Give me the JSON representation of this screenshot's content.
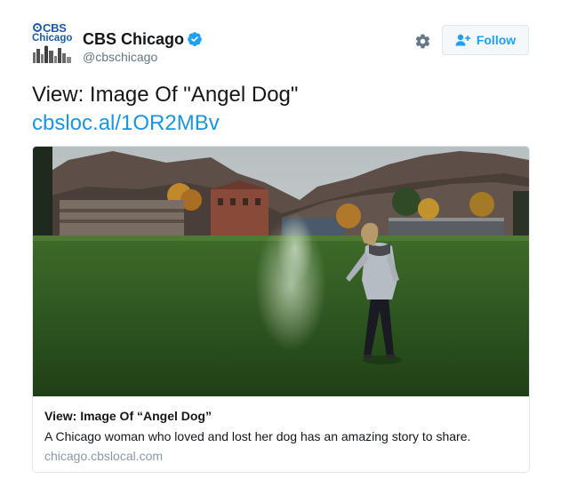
{
  "account": {
    "avatar_line1": "CBS",
    "avatar_line2": "Chicago",
    "display_name": "CBS Chicago",
    "handle": "@cbschicago",
    "verified_icon": "verified-badge-icon"
  },
  "actions": {
    "settings_icon": "gear-icon",
    "follow_label": "Follow",
    "follow_icon": "add-user-icon"
  },
  "tweet": {
    "text": "View: Image Of \"Angel Dog\"",
    "link": "cbsloc.al/1OR2MBv"
  },
  "card": {
    "image_description_icon": "photo",
    "title": "View: Image Of “Angel Dog”",
    "description": "A Chicago woman who loved and lost her dog has an amazing story to share.",
    "domain": "chicago.cbslocal.com"
  },
  "colors": {
    "brand_blue": "#1da1f2",
    "link_blue": "#1b95e0",
    "cbs_blue": "#1c5aa6",
    "text_dark": "#14171a",
    "text_gray": "#657786"
  }
}
